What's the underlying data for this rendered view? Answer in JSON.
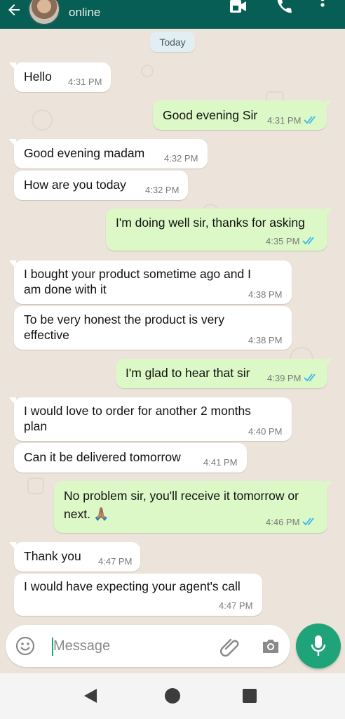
{
  "header": {
    "status": "online",
    "icons": [
      "back-arrow-icon",
      "video-call-icon",
      "voice-call-icon",
      "more-options-icon"
    ]
  },
  "chat": {
    "date_label": "Today",
    "messages": [
      {
        "direction": "in",
        "text": "Hello",
        "time": "4:31 PM"
      },
      {
        "direction": "out",
        "text": "Good evening Sir",
        "time": "4:31 PM",
        "read": true
      },
      {
        "direction": "in",
        "text": "Good evening madam",
        "time": "4:32 PM"
      },
      {
        "direction": "in",
        "text": "How are you today",
        "time": "4:32 PM"
      },
      {
        "direction": "out",
        "text": "I'm doing well sir, thanks for asking",
        "time": "4:35 PM",
        "read": true
      },
      {
        "direction": "in",
        "text_line1": "I bought your product sometime ago and I",
        "text_line2": "am done with it",
        "time": "4:38 PM"
      },
      {
        "direction": "in",
        "text_line1": "To be very honest the product is very",
        "text_line2": "effective",
        "time": "4:38 PM"
      },
      {
        "direction": "out",
        "text": "I'm glad to hear that sir",
        "time": "4:39 PM",
        "read": true
      },
      {
        "direction": "in",
        "text_line1": "I would love to order for another 2 months",
        "text_line2": "plan",
        "time": "4:40 PM"
      },
      {
        "direction": "in",
        "text": "Can it be delivered tomorrow",
        "time": "4:41 PM"
      },
      {
        "direction": "out",
        "text_line1": "No problem sir, you'll receive it tomorrow or",
        "text_line2": "next.",
        "emoji": "🙏🏽",
        "time": "4:46 PM",
        "read": true
      },
      {
        "direction": "in",
        "text": "Thank you",
        "time": "4:47 PM"
      },
      {
        "direction": "in",
        "text": "I would have expecting your agent's call",
        "time": "4:47 PM"
      }
    ]
  },
  "composer": {
    "placeholder": "Message",
    "value": ""
  },
  "colors": {
    "header": "#075e54",
    "outgoing_bubble": "#dcf8c6",
    "incoming_bubble": "#ffffff",
    "read_ticks": "#34b7f1",
    "mic_button": "#1fa47a"
  }
}
